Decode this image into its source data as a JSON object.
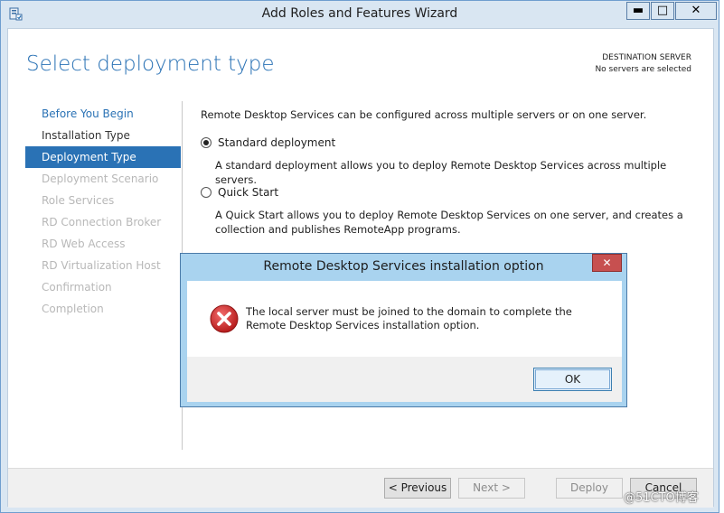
{
  "window": {
    "title": "Add Roles and Features Wizard",
    "minimize_glyph": "▬",
    "maximize_glyph": "□",
    "close_glyph": "✕"
  },
  "header": {
    "page_title": "Select deployment type",
    "destination_label": "DESTINATION SERVER",
    "destination_value": "No servers are selected"
  },
  "nav": {
    "items": [
      {
        "label": "Before You Begin",
        "state": "link"
      },
      {
        "label": "Installation Type",
        "state": "done"
      },
      {
        "label": "Deployment Type",
        "state": "active"
      },
      {
        "label": "Deployment Scenario",
        "state": "disabled"
      },
      {
        "label": "Role Services",
        "state": "disabled"
      },
      {
        "label": "RD Connection Broker",
        "state": "disabled"
      },
      {
        "label": "RD Web Access",
        "state": "disabled"
      },
      {
        "label": "RD Virtualization Host",
        "state": "disabled"
      },
      {
        "label": "Confirmation",
        "state": "disabled"
      },
      {
        "label": "Completion",
        "state": "disabled"
      }
    ]
  },
  "content": {
    "intro": "Remote Desktop Services can be configured across multiple servers or on one server.",
    "options": [
      {
        "label": "Standard deployment",
        "selected": true,
        "description": "A standard deployment allows you to deploy Remote Desktop Services across multiple servers."
      },
      {
        "label": "Quick Start",
        "selected": false,
        "description": "A Quick Start allows you to deploy Remote Desktop Services on one server, and creates a collection and publishes RemoteApp programs."
      }
    ]
  },
  "footer": {
    "previous": "< Previous",
    "next": "Next >",
    "deploy": "Deploy",
    "cancel": "Cancel"
  },
  "dialog": {
    "title": "Remote Desktop Services installation option",
    "close_glyph": "✕",
    "message": "The local server must be joined to the domain to complete the Remote Desktop Services installation option.",
    "ok": "OK",
    "icon": "error-icon"
  },
  "watermark": "@51CTO博客",
  "colors": {
    "accent": "#2a72b5",
    "window_frame": "#d9e6f2",
    "dialog_frame": "#a9d3ef",
    "close_red": "#c75050",
    "error_red": "#d32f2f"
  }
}
